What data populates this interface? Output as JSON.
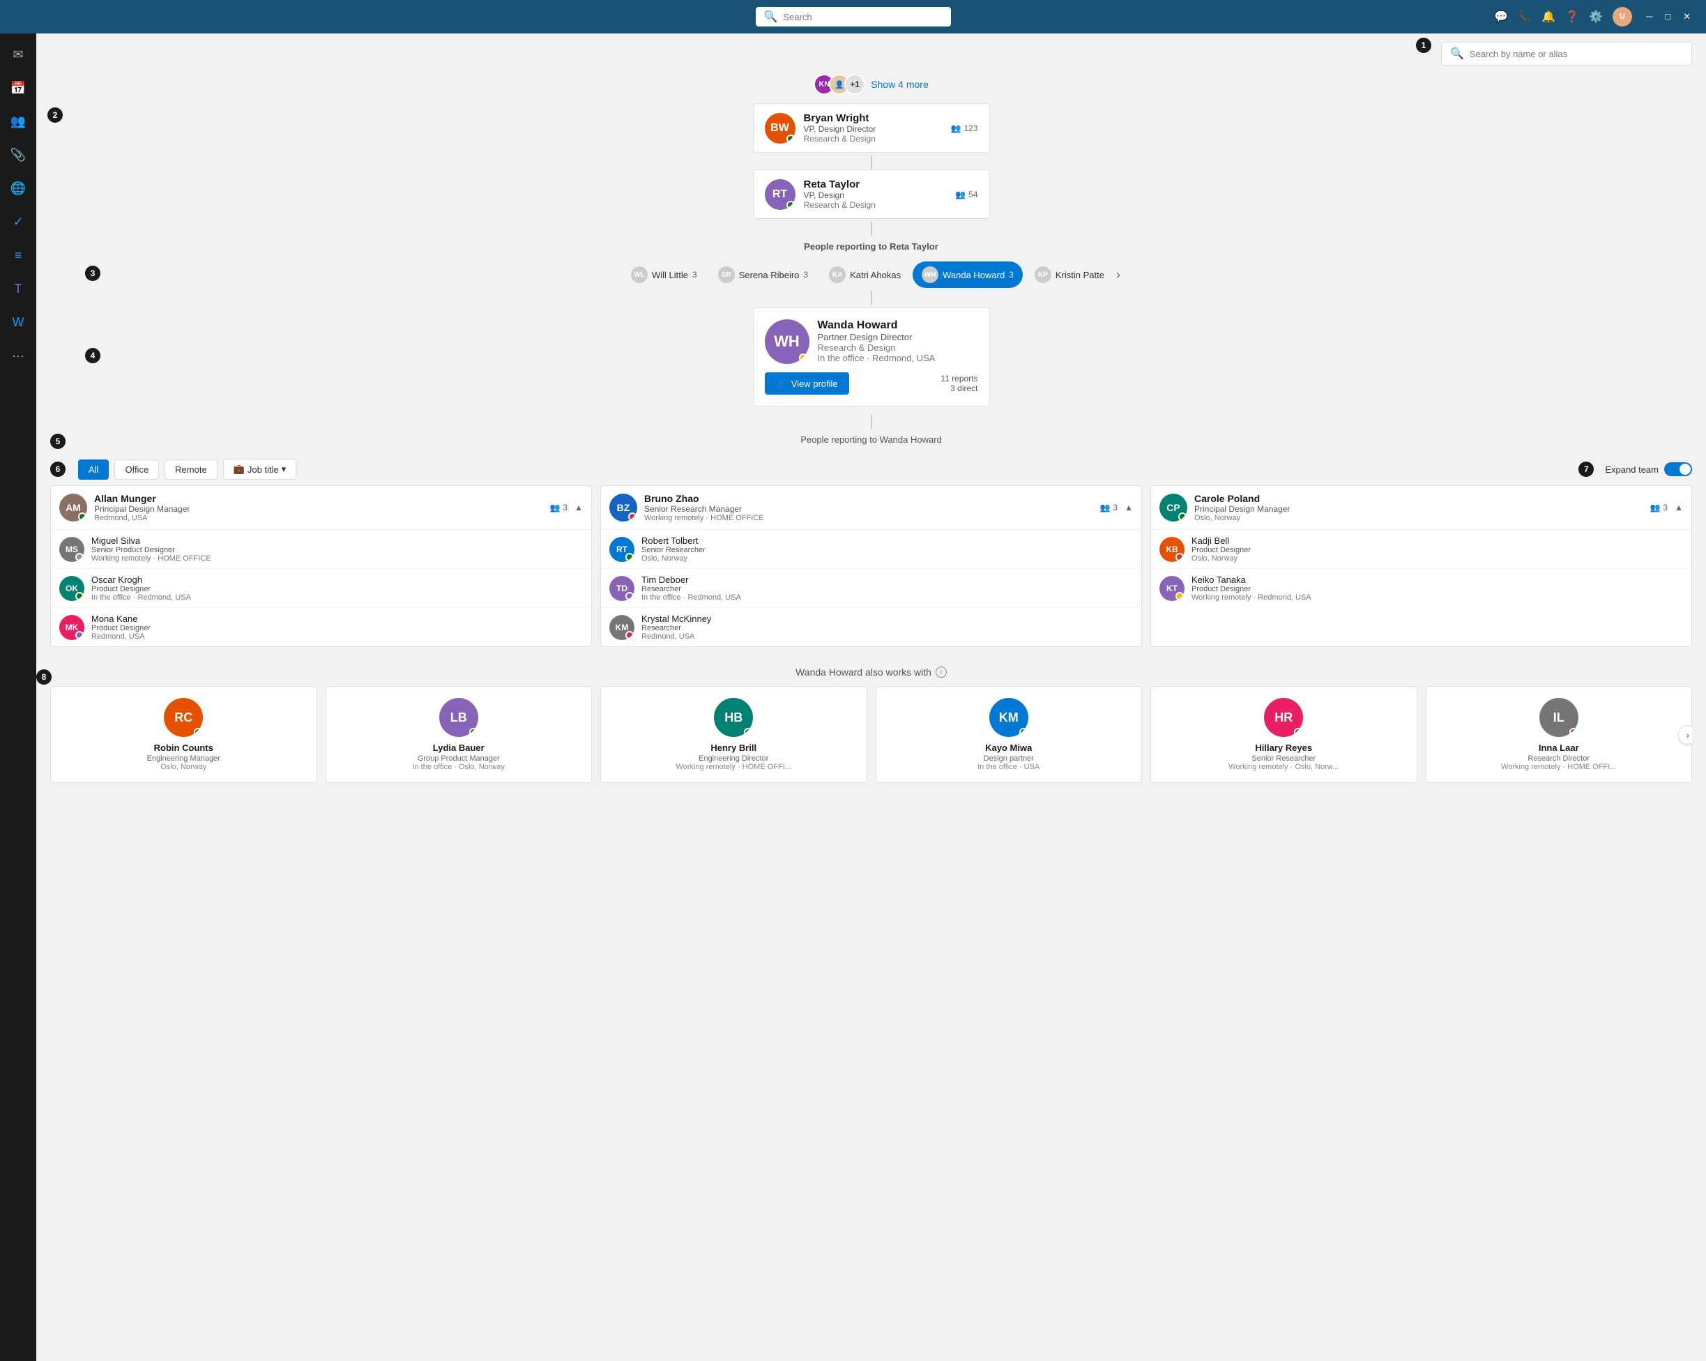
{
  "titlebar": {
    "search_placeholder": "Search",
    "icons": [
      "chat",
      "call",
      "bell",
      "help",
      "settings",
      "avatar"
    ]
  },
  "top_search": {
    "placeholder": "Search by name or alias"
  },
  "show_more": {
    "plus": "+1",
    "label": "Show 4 more"
  },
  "hierarchy": [
    {
      "name": "Bryan Wright",
      "title": "VP, Design Director",
      "dept": "Research & Design",
      "reports": "123",
      "status": "green",
      "initials": "BW"
    },
    {
      "name": "Reta Taylor",
      "title": "VP, Design",
      "dept": "Research & Design",
      "reports": "54",
      "status": "green",
      "initials": "RT"
    }
  ],
  "reports_to_label": "People reporting to",
  "reports_to_name": "Reta Taylor",
  "tabs": [
    {
      "name": "Will Little",
      "count": "3",
      "initials": "WL",
      "color": "av-blue"
    },
    {
      "name": "Serena Ribeiro",
      "count": "3",
      "initials": "SR",
      "color": "av-teal"
    },
    {
      "name": "Katri Ahokas",
      "count": "",
      "initials": "KA",
      "color": "av-orange"
    },
    {
      "name": "Wanda Howard",
      "count": "3",
      "initials": "WH",
      "color": "av-purple",
      "active": true
    },
    {
      "name": "Kristin Patte",
      "count": "",
      "initials": "KP",
      "color": "av-brown"
    }
  ],
  "selected_person": {
    "name": "Wanda Howard",
    "title": "Partner Design Director",
    "dept": "Research & Design",
    "location": "In the office · Redmond, USA",
    "status": "yellow",
    "initials": "WH",
    "reports_total": "11 reports",
    "reports_direct": "3 direct",
    "view_profile": "View profile"
  },
  "people_reporting_to": "People reporting to Wanda Howard",
  "filter": {
    "all": "All",
    "office": "Office",
    "remote": "Remote",
    "job_title": "Job title",
    "expand_team": "Expand team"
  },
  "team_groups": [
    {
      "name": "Allan Munger",
      "title": "Principal Design Manager",
      "location": "Redmond, USA",
      "reports": "3",
      "status": "green",
      "initials": "AM",
      "members": [
        {
          "name": "Miguel Silva",
          "title": "Senior Product Designer",
          "location": "Working remotely · HOME OFFICE",
          "status": "gray",
          "initials": "MS"
        },
        {
          "name": "Oscar Krogh",
          "title": "Product Designer",
          "location": "In the office · Redmond, USA",
          "status": "green",
          "initials": "OK",
          "initials_style": "av-teal"
        },
        {
          "name": "Mona Kane",
          "title": "Product Designer",
          "location": "Redmond, USA",
          "status": "purple",
          "initials": "MK"
        }
      ]
    },
    {
      "name": "Bruno Zhao",
      "title": "Senior Research Manager",
      "location": "Working remotely · HOME OFFICE",
      "reports": "3",
      "status": "red",
      "initials": "BZ",
      "members": [
        {
          "name": "Robert Tolbert",
          "title": "Senior Researcher",
          "location": "Oslo, Norway",
          "status": "green",
          "initials": "RT"
        },
        {
          "name": "Tim Deboer",
          "title": "Researcher",
          "location": "In the office · Redmond, USA",
          "status": "purple",
          "initials": "TD"
        },
        {
          "name": "Krystal McKinney",
          "title": "Researcher",
          "location": "Redmond, USA",
          "status": "red",
          "initials": "KM"
        }
      ]
    },
    {
      "name": "Carole Poland",
      "title": "Principal Design Manager",
      "location": "Oslo, Norway",
      "reports": "3",
      "status": "green",
      "initials": "CP",
      "members": [
        {
          "name": "Kadji Bell",
          "title": "Product Designer",
          "location": "Oslo, Norway",
          "status": "red",
          "initials": "KB"
        },
        {
          "name": "Keiko Tanaka",
          "title": "Product Designer",
          "location": "Working remotely · Redmond, USA",
          "status": "yellow",
          "initials": "KT"
        }
      ]
    }
  ],
  "also_works_with": {
    "title": "Wanda Howard also works with",
    "people": [
      {
        "name": "Robin Counts",
        "title": "Engineering Manager",
        "location": "Oslo, Norway",
        "initials": "RC",
        "color": "av-orange",
        "status": "green"
      },
      {
        "name": "Lydia Bauer",
        "title": "Group Product Manager",
        "location": "In the office · Oslo, Norway",
        "initials": "LB",
        "color": "av-purple",
        "status": "green"
      },
      {
        "name": "Henry Brill",
        "title": "Engineering Director",
        "location": "Working remotely · HOME OFFI...",
        "initials": "HB",
        "color": "av-teal",
        "status": "green"
      },
      {
        "name": "Kayo Miwa",
        "title": "Design partner",
        "location": "In the office · USA",
        "initials": "KM",
        "color": "av-blue",
        "status": "green"
      },
      {
        "name": "Hillary Reyes",
        "title": "Senior Researcher",
        "location": "Working remotely · Oslo, Norw...",
        "initials": "HR",
        "color": "av-pink",
        "status": "green"
      },
      {
        "name": "Inna Laar",
        "title": "Research Director",
        "location": "Working remotely · HOME OFFI...",
        "initials": "IL",
        "color": "av-gray",
        "status": "red"
      }
    ]
  },
  "numbered_labels": [
    "1",
    "2",
    "3",
    "4",
    "5",
    "6",
    "7",
    "8"
  ]
}
